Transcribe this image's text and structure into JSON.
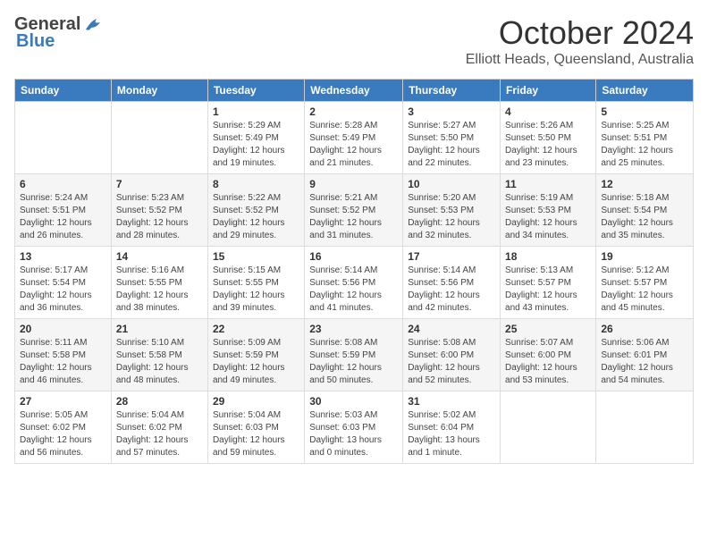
{
  "logo": {
    "general": "General",
    "blue": "Blue"
  },
  "title": {
    "month": "October 2024",
    "location": "Elliott Heads, Queensland, Australia"
  },
  "headers": [
    "Sunday",
    "Monday",
    "Tuesday",
    "Wednesday",
    "Thursday",
    "Friday",
    "Saturday"
  ],
  "weeks": [
    [
      {
        "date": "",
        "sunrise": "",
        "sunset": "",
        "daylight": ""
      },
      {
        "date": "",
        "sunrise": "",
        "sunset": "",
        "daylight": ""
      },
      {
        "date": "1",
        "sunrise": "Sunrise: 5:29 AM",
        "sunset": "Sunset: 5:49 PM",
        "daylight": "Daylight: 12 hours and 19 minutes."
      },
      {
        "date": "2",
        "sunrise": "Sunrise: 5:28 AM",
        "sunset": "Sunset: 5:49 PM",
        "daylight": "Daylight: 12 hours and 21 minutes."
      },
      {
        "date": "3",
        "sunrise": "Sunrise: 5:27 AM",
        "sunset": "Sunset: 5:50 PM",
        "daylight": "Daylight: 12 hours and 22 minutes."
      },
      {
        "date": "4",
        "sunrise": "Sunrise: 5:26 AM",
        "sunset": "Sunset: 5:50 PM",
        "daylight": "Daylight: 12 hours and 23 minutes."
      },
      {
        "date": "5",
        "sunrise": "Sunrise: 5:25 AM",
        "sunset": "Sunset: 5:51 PM",
        "daylight": "Daylight: 12 hours and 25 minutes."
      }
    ],
    [
      {
        "date": "6",
        "sunrise": "Sunrise: 5:24 AM",
        "sunset": "Sunset: 5:51 PM",
        "daylight": "Daylight: 12 hours and 26 minutes."
      },
      {
        "date": "7",
        "sunrise": "Sunrise: 5:23 AM",
        "sunset": "Sunset: 5:52 PM",
        "daylight": "Daylight: 12 hours and 28 minutes."
      },
      {
        "date": "8",
        "sunrise": "Sunrise: 5:22 AM",
        "sunset": "Sunset: 5:52 PM",
        "daylight": "Daylight: 12 hours and 29 minutes."
      },
      {
        "date": "9",
        "sunrise": "Sunrise: 5:21 AM",
        "sunset": "Sunset: 5:52 PM",
        "daylight": "Daylight: 12 hours and 31 minutes."
      },
      {
        "date": "10",
        "sunrise": "Sunrise: 5:20 AM",
        "sunset": "Sunset: 5:53 PM",
        "daylight": "Daylight: 12 hours and 32 minutes."
      },
      {
        "date": "11",
        "sunrise": "Sunrise: 5:19 AM",
        "sunset": "Sunset: 5:53 PM",
        "daylight": "Daylight: 12 hours and 34 minutes."
      },
      {
        "date": "12",
        "sunrise": "Sunrise: 5:18 AM",
        "sunset": "Sunset: 5:54 PM",
        "daylight": "Daylight: 12 hours and 35 minutes."
      }
    ],
    [
      {
        "date": "13",
        "sunrise": "Sunrise: 5:17 AM",
        "sunset": "Sunset: 5:54 PM",
        "daylight": "Daylight: 12 hours and 36 minutes."
      },
      {
        "date": "14",
        "sunrise": "Sunrise: 5:16 AM",
        "sunset": "Sunset: 5:55 PM",
        "daylight": "Daylight: 12 hours and 38 minutes."
      },
      {
        "date": "15",
        "sunrise": "Sunrise: 5:15 AM",
        "sunset": "Sunset: 5:55 PM",
        "daylight": "Daylight: 12 hours and 39 minutes."
      },
      {
        "date": "16",
        "sunrise": "Sunrise: 5:14 AM",
        "sunset": "Sunset: 5:56 PM",
        "daylight": "Daylight: 12 hours and 41 minutes."
      },
      {
        "date": "17",
        "sunrise": "Sunrise: 5:14 AM",
        "sunset": "Sunset: 5:56 PM",
        "daylight": "Daylight: 12 hours and 42 minutes."
      },
      {
        "date": "18",
        "sunrise": "Sunrise: 5:13 AM",
        "sunset": "Sunset: 5:57 PM",
        "daylight": "Daylight: 12 hours and 43 minutes."
      },
      {
        "date": "19",
        "sunrise": "Sunrise: 5:12 AM",
        "sunset": "Sunset: 5:57 PM",
        "daylight": "Daylight: 12 hours and 45 minutes."
      }
    ],
    [
      {
        "date": "20",
        "sunrise": "Sunrise: 5:11 AM",
        "sunset": "Sunset: 5:58 PM",
        "daylight": "Daylight: 12 hours and 46 minutes."
      },
      {
        "date": "21",
        "sunrise": "Sunrise: 5:10 AM",
        "sunset": "Sunset: 5:58 PM",
        "daylight": "Daylight: 12 hours and 48 minutes."
      },
      {
        "date": "22",
        "sunrise": "Sunrise: 5:09 AM",
        "sunset": "Sunset: 5:59 PM",
        "daylight": "Daylight: 12 hours and 49 minutes."
      },
      {
        "date": "23",
        "sunrise": "Sunrise: 5:08 AM",
        "sunset": "Sunset: 5:59 PM",
        "daylight": "Daylight: 12 hours and 50 minutes."
      },
      {
        "date": "24",
        "sunrise": "Sunrise: 5:08 AM",
        "sunset": "Sunset: 6:00 PM",
        "daylight": "Daylight: 12 hours and 52 minutes."
      },
      {
        "date": "25",
        "sunrise": "Sunrise: 5:07 AM",
        "sunset": "Sunset: 6:00 PM",
        "daylight": "Daylight: 12 hours and 53 minutes."
      },
      {
        "date": "26",
        "sunrise": "Sunrise: 5:06 AM",
        "sunset": "Sunset: 6:01 PM",
        "daylight": "Daylight: 12 hours and 54 minutes."
      }
    ],
    [
      {
        "date": "27",
        "sunrise": "Sunrise: 5:05 AM",
        "sunset": "Sunset: 6:02 PM",
        "daylight": "Daylight: 12 hours and 56 minutes."
      },
      {
        "date": "28",
        "sunrise": "Sunrise: 5:04 AM",
        "sunset": "Sunset: 6:02 PM",
        "daylight": "Daylight: 12 hours and 57 minutes."
      },
      {
        "date": "29",
        "sunrise": "Sunrise: 5:04 AM",
        "sunset": "Sunset: 6:03 PM",
        "daylight": "Daylight: 12 hours and 59 minutes."
      },
      {
        "date": "30",
        "sunrise": "Sunrise: 5:03 AM",
        "sunset": "Sunset: 6:03 PM",
        "daylight": "Daylight: 13 hours and 0 minutes."
      },
      {
        "date": "31",
        "sunrise": "Sunrise: 5:02 AM",
        "sunset": "Sunset: 6:04 PM",
        "daylight": "Daylight: 13 hours and 1 minute."
      },
      {
        "date": "",
        "sunrise": "",
        "sunset": "",
        "daylight": ""
      },
      {
        "date": "",
        "sunrise": "",
        "sunset": "",
        "daylight": ""
      }
    ]
  ]
}
